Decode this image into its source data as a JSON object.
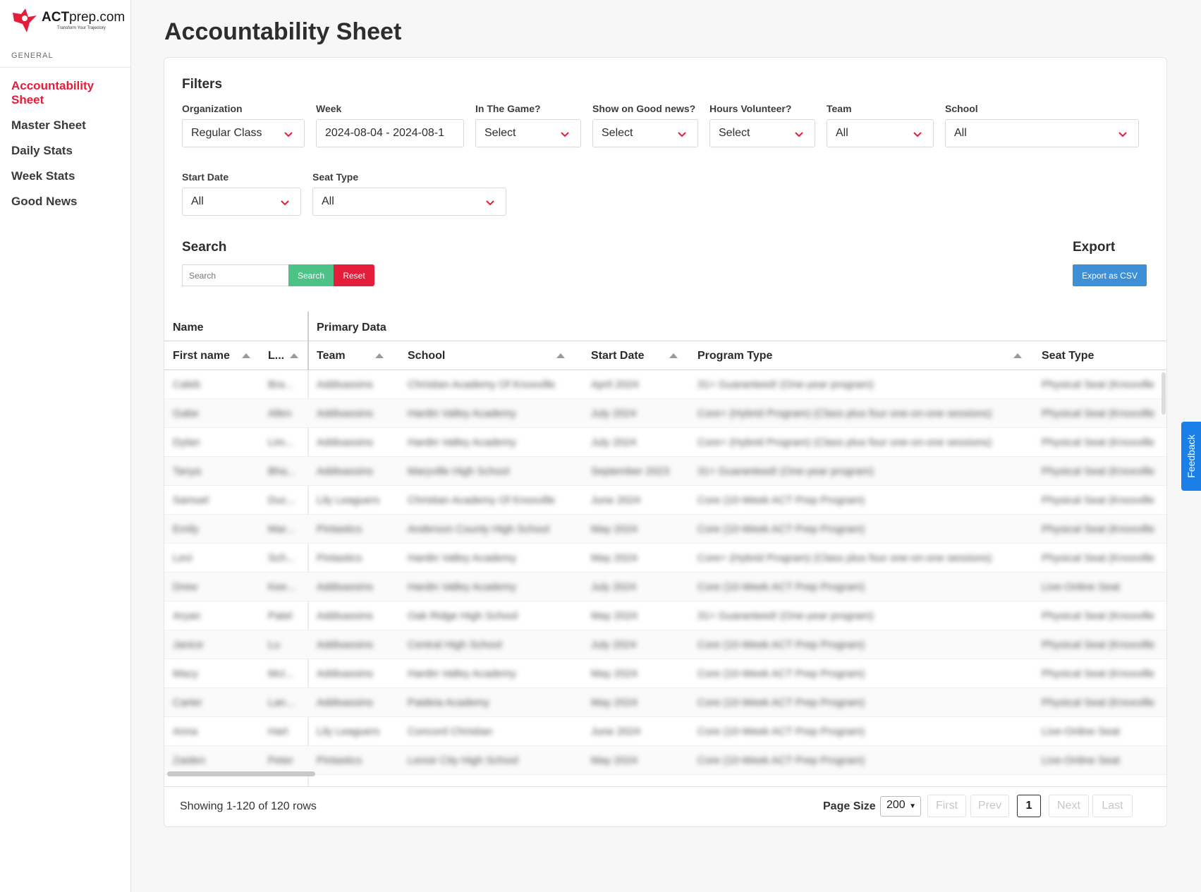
{
  "brand": {
    "name_bold": "ACT",
    "name_rest": "prep.com",
    "tagline": "Transform Your Trajectory"
  },
  "sidebar": {
    "section_label": "GENERAL",
    "items": [
      {
        "label": "Accountability Sheet",
        "active": true
      },
      {
        "label": "Master Sheet"
      },
      {
        "label": "Daily Stats"
      },
      {
        "label": "Week Stats"
      },
      {
        "label": "Good News"
      }
    ]
  },
  "page": {
    "title": "Accountability Sheet"
  },
  "filters": {
    "title": "Filters",
    "organization": {
      "label": "Organization",
      "value": "Regular Class"
    },
    "week": {
      "label": "Week",
      "value": "2024-08-04 - 2024-08-1"
    },
    "in_the_game": {
      "label": "In The Game?",
      "value": "Select"
    },
    "good_news": {
      "label": "Show on Good news?",
      "value": "Select"
    },
    "hours_volunteer": {
      "label": "Hours Volunteer?",
      "value": "Select"
    },
    "team": {
      "label": "Team",
      "value": "All"
    },
    "school": {
      "label": "School",
      "value": "All"
    },
    "start_date": {
      "label": "Start Date",
      "value": "All"
    },
    "seat_type": {
      "label": "Seat Type",
      "value": "All"
    }
  },
  "search": {
    "title": "Search",
    "placeholder": "Search",
    "search_label": "Search",
    "reset_label": "Reset"
  },
  "export": {
    "title": "Export",
    "button_label": "Export as CSV"
  },
  "table": {
    "group_headers": {
      "name": "Name",
      "primary": "Primary Data"
    },
    "columns": {
      "first_name": "First name",
      "last_name": "L...",
      "team": "Team",
      "school": "School",
      "start_date": "Start Date",
      "program_type": "Program Type",
      "seat_type": "Seat Type"
    },
    "rows": [
      {
        "first": "Caleb",
        "last": "Bra...",
        "team": "Addisassins",
        "school": "Christian Academy Of Knoxville",
        "start": "April 2024",
        "program": "31+ Guaranteed! (One-year program)",
        "seat": "Physical Seat (Knoxville"
      },
      {
        "first": "Gabe",
        "last": "Allen",
        "team": "Addisassins",
        "school": "Hardin Valley Academy",
        "start": "July 2024",
        "program": "Core+ (Hybrid Program) (Class plus four one-on-one sessions)",
        "seat": "Physical Seat (Knoxville"
      },
      {
        "first": "Dylan",
        "last": "Lim...",
        "team": "Addisassins",
        "school": "Hardin Valley Academy",
        "start": "July 2024",
        "program": "Core+ (Hybrid Program) (Class plus four one-on-one sessions)",
        "seat": "Physical Seat (Knoxville"
      },
      {
        "first": "Tanya",
        "last": "Bha...",
        "team": "Addisassins",
        "school": "Maryville High School",
        "start": "September 2023",
        "program": "31+ Guaranteed! (One-year program)",
        "seat": "Physical Seat (Knoxville"
      },
      {
        "first": "Samuel",
        "last": "Duc...",
        "team": "Lily Leaguers",
        "school": "Christian Academy Of Knoxville",
        "start": "June 2024",
        "program": "Core (10-Week ACT Prep Program)",
        "seat": "Physical Seat (Knoxville"
      },
      {
        "first": "Emily",
        "last": "Mar...",
        "team": "Pintastics",
        "school": "Anderson County High School",
        "start": "May 2024",
        "program": "Core (10-Week ACT Prep Program)",
        "seat": "Physical Seat (Knoxville"
      },
      {
        "first": "Levi",
        "last": "Sch...",
        "team": "Pintastics",
        "school": "Hardin Valley Academy",
        "start": "May 2024",
        "program": "Core+ (Hybrid Program) (Class plus four one-on-one sessions)",
        "seat": "Physical Seat (Knoxville"
      },
      {
        "first": "Drew",
        "last": "Kee...",
        "team": "Addisassins",
        "school": "Hardin Valley Academy",
        "start": "July 2024",
        "program": "Core (10-Week ACT Prep Program)",
        "seat": "Live-Online Seat"
      },
      {
        "first": "Aryan",
        "last": "Patel",
        "team": "Addisassins",
        "school": "Oak Ridge High School",
        "start": "May 2024",
        "program": "31+ Guaranteed! (One-year program)",
        "seat": "Physical Seat (Knoxville"
      },
      {
        "first": "Janice",
        "last": "Lu",
        "team": "Addisassins",
        "school": "Central High School",
        "start": "July 2024",
        "program": "Core (10-Week ACT Prep Program)",
        "seat": "Physical Seat (Knoxville"
      },
      {
        "first": "Macy",
        "last": "McI...",
        "team": "Addisassins",
        "school": "Hardin Valley Academy",
        "start": "May 2024",
        "program": "Core (10-Week ACT Prep Program)",
        "seat": "Physical Seat (Knoxville"
      },
      {
        "first": "Carter",
        "last": "Lan...",
        "team": "Addisassins",
        "school": "Paideia Academy",
        "start": "May 2024",
        "program": "Core (10-Week ACT Prep Program)",
        "seat": "Physical Seat (Knoxville"
      },
      {
        "first": "Anna",
        "last": "Hart",
        "team": "Lily Leaguers",
        "school": "Concord Christian",
        "start": "June 2024",
        "program": "Core (10-Week ACT Prep Program)",
        "seat": "Live-Online Seat"
      },
      {
        "first": "Zaiden",
        "last": "Peter",
        "team": "Pintastics",
        "school": "Lenoir City High School",
        "start": "May 2024",
        "program": "Core (10-Week ACT Prep Program)",
        "seat": "Live-Online Seat"
      }
    ]
  },
  "footer": {
    "showing": "Showing 1-120 of 120 rows",
    "page_size_label": "Page Size",
    "page_size_value": "200",
    "first": "First",
    "prev": "Prev",
    "current": "1",
    "next": "Next",
    "last": "Last"
  },
  "feedback": {
    "label": "Feedback"
  },
  "colors": {
    "brand_red": "#e41d3b",
    "search_green": "#4cc286",
    "export_blue": "#3d8fd6",
    "feedback_blue": "#1a7fe6"
  }
}
